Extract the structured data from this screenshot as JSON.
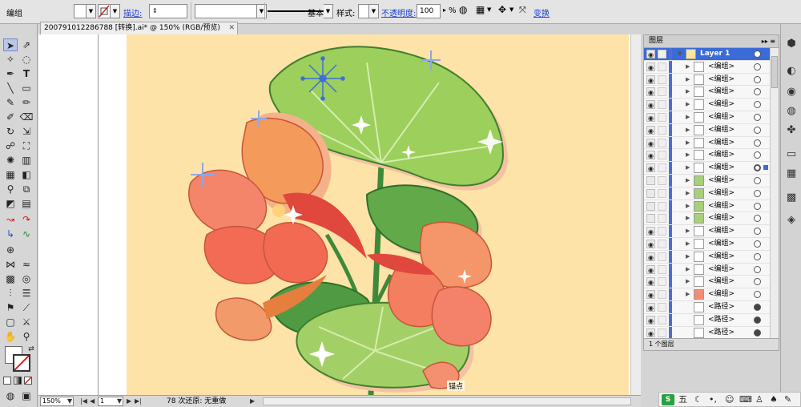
{
  "control_bar": {
    "group_label": "编组",
    "stroke_label": "描边:",
    "stroke_style": "基本",
    "style_label": "样式:",
    "opacity_label": "不透明度:",
    "opacity_value": "100",
    "opacity_unit": "%",
    "transform_label": "变换"
  },
  "document": {
    "tab_title": "200791012286788 [转换].ai* @ 150% (RGB/预览)",
    "tooltip": "锚点"
  },
  "status_bar": {
    "zoom": "150%",
    "page": "1",
    "status_text": "78 次还原: 无重做"
  },
  "layers_panel": {
    "title": "图层",
    "layers": [
      {
        "name": "Layer 1",
        "type": "layer",
        "thumb": "layer",
        "target": "empty",
        "selected_square": false
      },
      {
        "name": "<编组>",
        "type": "group",
        "thumb": "blank",
        "target": "empty",
        "selected_square": false
      },
      {
        "name": "<编组>",
        "type": "group",
        "thumb": "blank",
        "target": "empty",
        "selected_square": false
      },
      {
        "name": "<编组>",
        "type": "group",
        "thumb": "blank",
        "target": "empty",
        "selected_square": false
      },
      {
        "name": "<编组>",
        "type": "group",
        "thumb": "blank",
        "target": "empty",
        "selected_square": false
      },
      {
        "name": "<编组>",
        "type": "group",
        "thumb": "blank",
        "target": "empty",
        "selected_square": false
      },
      {
        "name": "<编组>",
        "type": "group",
        "thumb": "blank",
        "target": "empty",
        "selected_square": false
      },
      {
        "name": "<编组>",
        "type": "group",
        "thumb": "blank",
        "target": "empty",
        "selected_square": false
      },
      {
        "name": "<编组>",
        "type": "group",
        "thumb": "blank",
        "target": "empty",
        "selected_square": false
      },
      {
        "name": "<编组>",
        "type": "group",
        "thumb": "blank",
        "target": "ring",
        "selected_square": true
      },
      {
        "name": "<编组>",
        "type": "group",
        "thumb": "leaf",
        "target": "empty",
        "selected_square": false
      },
      {
        "name": "<编组>",
        "type": "group",
        "thumb": "leaf",
        "target": "empty",
        "selected_square": false
      },
      {
        "name": "<编组>",
        "type": "group",
        "thumb": "leaf",
        "target": "empty",
        "selected_square": false
      },
      {
        "name": "<编组>",
        "type": "group",
        "thumb": "leaf",
        "target": "empty",
        "selected_square": false
      },
      {
        "name": "<编组>",
        "type": "group",
        "thumb": "blank",
        "target": "empty",
        "selected_square": false
      },
      {
        "name": "<编组>",
        "type": "group",
        "thumb": "blank",
        "target": "empty",
        "selected_square": false
      },
      {
        "name": "<编组>",
        "type": "group",
        "thumb": "blank",
        "target": "empty",
        "selected_square": false
      },
      {
        "name": "<编组>",
        "type": "group",
        "thumb": "blank",
        "target": "empty",
        "selected_square": false
      },
      {
        "name": "<编组>",
        "type": "group",
        "thumb": "blank",
        "target": "empty",
        "selected_square": false
      },
      {
        "name": "<编组>",
        "type": "group",
        "thumb": "flower",
        "target": "empty",
        "selected_square": false
      },
      {
        "name": "<路径>",
        "type": "path",
        "thumb": "blank",
        "target": "filled",
        "selected_square": false
      },
      {
        "name": "<路径>",
        "type": "path",
        "thumb": "blank",
        "target": "filled",
        "selected_square": false
      },
      {
        "name": "<路径>",
        "type": "path",
        "thumb": "blank",
        "target": "filled",
        "selected_square": false
      }
    ],
    "footer_text": "1 个图层"
  },
  "ime": {
    "mode": "五"
  },
  "colors": {
    "artboard": "#fde3a7",
    "accent": "#3a6bd6",
    "link": "#1a3fd6"
  }
}
